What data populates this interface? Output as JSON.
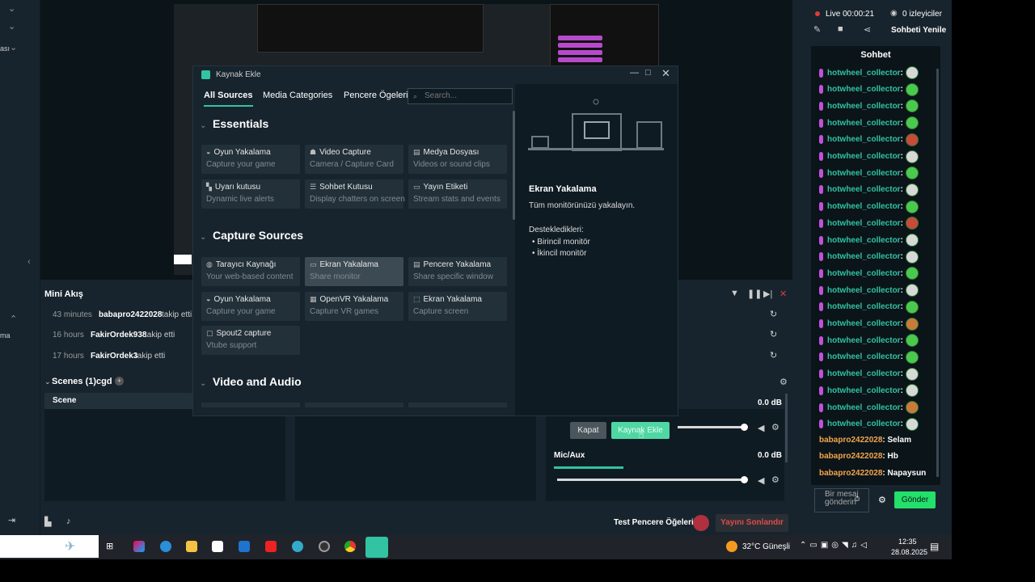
{
  "header": {
    "live_time": "Live 00:00:21",
    "viewers": "0 izleyiciler",
    "refresh_chat": "Sohbeti Yenile"
  },
  "chat": {
    "title": "Sohbet",
    "repeated_user": "hotwheel_collector",
    "messages": [
      {
        "user": "babapro2422028",
        "text": "Selam"
      },
      {
        "user": "babapro2422028",
        "text": "Hb"
      },
      {
        "user": "babapro2422028",
        "text": "Napaysun"
      }
    ],
    "input_placeholder": "Bir mesaj gönderin",
    "send_label": "Gönder"
  },
  "mini_feed": {
    "title": "Mini Akış",
    "rows": [
      {
        "time": "43 minutes",
        "user": "babapro2422028",
        "action": "takip etti"
      },
      {
        "time": "16 hours",
        "user": "FakirOrdek938",
        "action": "takip etti"
      },
      {
        "time": "17 hours",
        "user": "FakirOrdek3",
        "action": "takip etti"
      }
    ]
  },
  "scenes": {
    "title": "Scenes (1)cgd",
    "column": "Scene"
  },
  "audio": {
    "db1": "0.0 dB",
    "mic_label": "Mic/Aux",
    "db2": "0.0 dB"
  },
  "footer": {
    "test_label": "Test Pencere Öğeleri",
    "end_stream": "Yayını Sonlandır"
  },
  "modal": {
    "title": "Kaynak Ekle",
    "tabs": [
      "All Sources",
      "Media Categories",
      "Pencere Ögeleri"
    ],
    "search_placeholder": "Search...",
    "sections": {
      "essentials": "Essentials",
      "capture": "Capture Sources",
      "video_audio": "Video and Audio"
    },
    "essentials_cards": [
      {
        "title": "Oyun Yakalama",
        "desc": "Capture your game"
      },
      {
        "title": "Video Capture",
        "desc": "Camera / Capture Card"
      },
      {
        "title": "Medya Dosyası",
        "desc": "Videos or sound clips"
      },
      {
        "title": "Uyarı kutusu",
        "desc": "Dynamic live alerts"
      },
      {
        "title": "Sohbet Kutusu",
        "desc": "Display chatters on screen"
      },
      {
        "title": "Yayın Etiketi",
        "desc": "Stream stats and events"
      }
    ],
    "capture_cards": [
      {
        "title": "Tarayıcı Kaynağı",
        "desc": "Your web-based content"
      },
      {
        "title": "Ekran Yakalama",
        "desc": "Share monitor"
      },
      {
        "title": "Pencere Yakalama",
        "desc": "Share specific window"
      },
      {
        "title": "Oyun Yakalama",
        "desc": "Capture your game"
      },
      {
        "title": "OpenVR Yakalama",
        "desc": "Capture VR games"
      },
      {
        "title": "Ekran Yakalama",
        "desc": "Capture screen"
      },
      {
        "title": "Spout2 capture",
        "desc": "Vtube support"
      }
    ],
    "detail": {
      "title": "Ekran Yakalama",
      "desc": "Tüm monitörünüzü yakalayın.",
      "supported_label": "Destekledikleri:",
      "supported": [
        "Birincil monitör",
        "İkincil monitör"
      ]
    },
    "close_label": "Kapat",
    "add_label": "Kaynak Ekle"
  },
  "taskbar": {
    "weather": "32°C Güneşli",
    "time": "12:35",
    "date": "28.08.2025"
  }
}
